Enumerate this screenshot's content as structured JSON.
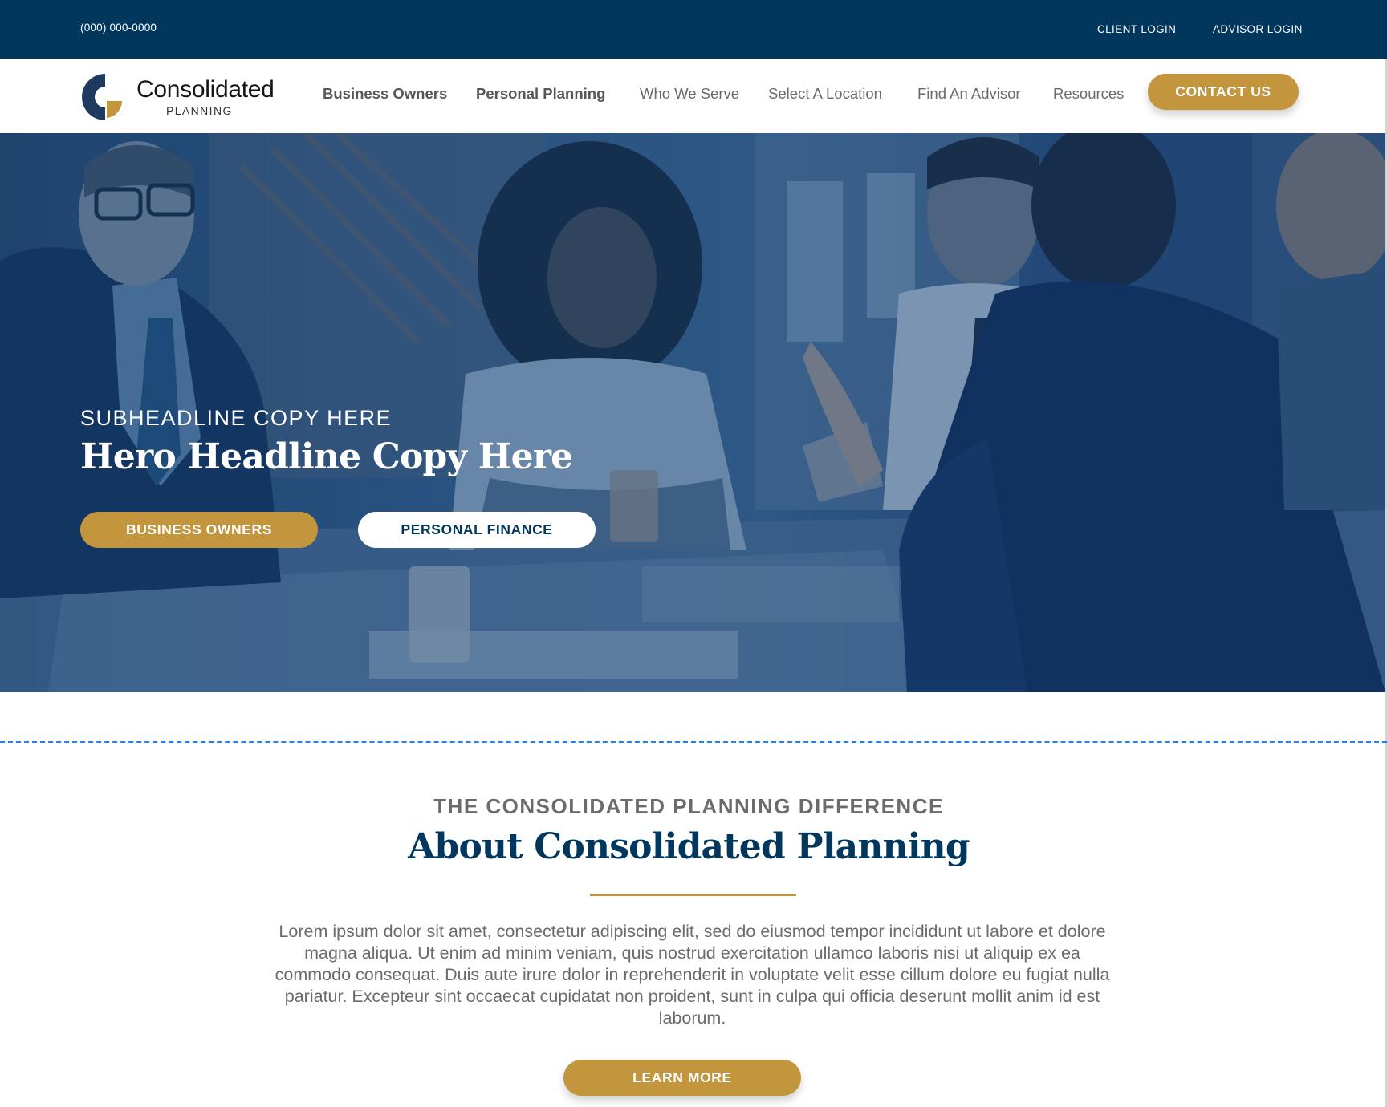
{
  "topbar": {
    "phone": "(000) 000-0000",
    "client_login": "CLIENT LOGIN",
    "advisor_login": "ADVISOR LOGIN"
  },
  "logo": {
    "name": "Consolidated",
    "sub": "PLANNING",
    "icon": "consolidated-planning-logo-mark",
    "colors": {
      "navy": "#1e3a5f",
      "gold": "#c3963e"
    }
  },
  "nav": {
    "items": [
      {
        "label": "Business Owners",
        "bold": true
      },
      {
        "label": "Personal Planning",
        "bold": true
      },
      {
        "label": "Who We Serve",
        "bold": false
      },
      {
        "label": "Select A Location",
        "bold": false
      },
      {
        "label": "Find An Advisor",
        "bold": false
      },
      {
        "label": "Resources",
        "bold": false
      }
    ],
    "contact_label": "CONTACT US"
  },
  "hero": {
    "subheadline": "SUBHEADLINE COPY HERE",
    "headline": "Hero Headline Copy Here",
    "btn_business": "BUSINESS OWNERS",
    "btn_personal": "PERSONAL FINANCE"
  },
  "about": {
    "eyebrow": "THE CONSOLIDATED PLANNING DIFFERENCE",
    "title": "About Consolidated Planning",
    "body": "Lorem ipsum dolor sit amet, consectetur adipiscing elit, sed do eiusmod tempor incididunt ut labore et dolore magna aliqua. Ut enim ad minim veniam, quis nostrud exercitation ullamco laboris nisi ut aliquip ex ea commodo consequat. Duis aute irure dolor in reprehenderit in voluptate velit esse cillum dolore eu fugiat nulla pariatur. Excepteur sint occaecat cupidatat non proident, sunt in culpa qui officia deserunt mollit anim id est laborum.",
    "learn_more": "LEARN MORE"
  },
  "colors": {
    "navy": "#01365d",
    "gold": "#c3963e",
    "text_gray": "#6b6b6b",
    "divider_blue": "#2b7de3"
  }
}
